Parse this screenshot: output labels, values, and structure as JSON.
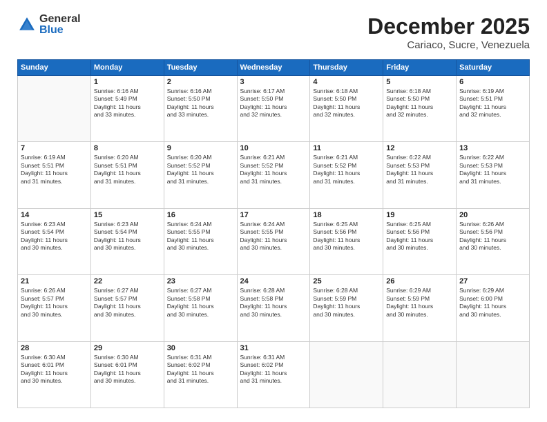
{
  "header": {
    "logo_general": "General",
    "logo_blue": "Blue",
    "month_title": "December 2025",
    "location": "Cariaco, Sucre, Venezuela"
  },
  "weekdays": [
    "Sunday",
    "Monday",
    "Tuesday",
    "Wednesday",
    "Thursday",
    "Friday",
    "Saturday"
  ],
  "weeks": [
    [
      {
        "day": "",
        "info": ""
      },
      {
        "day": "1",
        "info": "Sunrise: 6:16 AM\nSunset: 5:49 PM\nDaylight: 11 hours\nand 33 minutes."
      },
      {
        "day": "2",
        "info": "Sunrise: 6:16 AM\nSunset: 5:50 PM\nDaylight: 11 hours\nand 33 minutes."
      },
      {
        "day": "3",
        "info": "Sunrise: 6:17 AM\nSunset: 5:50 PM\nDaylight: 11 hours\nand 32 minutes."
      },
      {
        "day": "4",
        "info": "Sunrise: 6:18 AM\nSunset: 5:50 PM\nDaylight: 11 hours\nand 32 minutes."
      },
      {
        "day": "5",
        "info": "Sunrise: 6:18 AM\nSunset: 5:50 PM\nDaylight: 11 hours\nand 32 minutes."
      },
      {
        "day": "6",
        "info": "Sunrise: 6:19 AM\nSunset: 5:51 PM\nDaylight: 11 hours\nand 32 minutes."
      }
    ],
    [
      {
        "day": "7",
        "info": "Sunrise: 6:19 AM\nSunset: 5:51 PM\nDaylight: 11 hours\nand 31 minutes."
      },
      {
        "day": "8",
        "info": "Sunrise: 6:20 AM\nSunset: 5:51 PM\nDaylight: 11 hours\nand 31 minutes."
      },
      {
        "day": "9",
        "info": "Sunrise: 6:20 AM\nSunset: 5:52 PM\nDaylight: 11 hours\nand 31 minutes."
      },
      {
        "day": "10",
        "info": "Sunrise: 6:21 AM\nSunset: 5:52 PM\nDaylight: 11 hours\nand 31 minutes."
      },
      {
        "day": "11",
        "info": "Sunrise: 6:21 AM\nSunset: 5:52 PM\nDaylight: 11 hours\nand 31 minutes."
      },
      {
        "day": "12",
        "info": "Sunrise: 6:22 AM\nSunset: 5:53 PM\nDaylight: 11 hours\nand 31 minutes."
      },
      {
        "day": "13",
        "info": "Sunrise: 6:22 AM\nSunset: 5:53 PM\nDaylight: 11 hours\nand 31 minutes."
      }
    ],
    [
      {
        "day": "14",
        "info": "Sunrise: 6:23 AM\nSunset: 5:54 PM\nDaylight: 11 hours\nand 30 minutes."
      },
      {
        "day": "15",
        "info": "Sunrise: 6:23 AM\nSunset: 5:54 PM\nDaylight: 11 hours\nand 30 minutes."
      },
      {
        "day": "16",
        "info": "Sunrise: 6:24 AM\nSunset: 5:55 PM\nDaylight: 11 hours\nand 30 minutes."
      },
      {
        "day": "17",
        "info": "Sunrise: 6:24 AM\nSunset: 5:55 PM\nDaylight: 11 hours\nand 30 minutes."
      },
      {
        "day": "18",
        "info": "Sunrise: 6:25 AM\nSunset: 5:56 PM\nDaylight: 11 hours\nand 30 minutes."
      },
      {
        "day": "19",
        "info": "Sunrise: 6:25 AM\nSunset: 5:56 PM\nDaylight: 11 hours\nand 30 minutes."
      },
      {
        "day": "20",
        "info": "Sunrise: 6:26 AM\nSunset: 5:56 PM\nDaylight: 11 hours\nand 30 minutes."
      }
    ],
    [
      {
        "day": "21",
        "info": "Sunrise: 6:26 AM\nSunset: 5:57 PM\nDaylight: 11 hours\nand 30 minutes."
      },
      {
        "day": "22",
        "info": "Sunrise: 6:27 AM\nSunset: 5:57 PM\nDaylight: 11 hours\nand 30 minutes."
      },
      {
        "day": "23",
        "info": "Sunrise: 6:27 AM\nSunset: 5:58 PM\nDaylight: 11 hours\nand 30 minutes."
      },
      {
        "day": "24",
        "info": "Sunrise: 6:28 AM\nSunset: 5:58 PM\nDaylight: 11 hours\nand 30 minutes."
      },
      {
        "day": "25",
        "info": "Sunrise: 6:28 AM\nSunset: 5:59 PM\nDaylight: 11 hours\nand 30 minutes."
      },
      {
        "day": "26",
        "info": "Sunrise: 6:29 AM\nSunset: 5:59 PM\nDaylight: 11 hours\nand 30 minutes."
      },
      {
        "day": "27",
        "info": "Sunrise: 6:29 AM\nSunset: 6:00 PM\nDaylight: 11 hours\nand 30 minutes."
      }
    ],
    [
      {
        "day": "28",
        "info": "Sunrise: 6:30 AM\nSunset: 6:01 PM\nDaylight: 11 hours\nand 30 minutes."
      },
      {
        "day": "29",
        "info": "Sunrise: 6:30 AM\nSunset: 6:01 PM\nDaylight: 11 hours\nand 30 minutes."
      },
      {
        "day": "30",
        "info": "Sunrise: 6:31 AM\nSunset: 6:02 PM\nDaylight: 11 hours\nand 31 minutes."
      },
      {
        "day": "31",
        "info": "Sunrise: 6:31 AM\nSunset: 6:02 PM\nDaylight: 11 hours\nand 31 minutes."
      },
      {
        "day": "",
        "info": ""
      },
      {
        "day": "",
        "info": ""
      },
      {
        "day": "",
        "info": ""
      }
    ]
  ]
}
